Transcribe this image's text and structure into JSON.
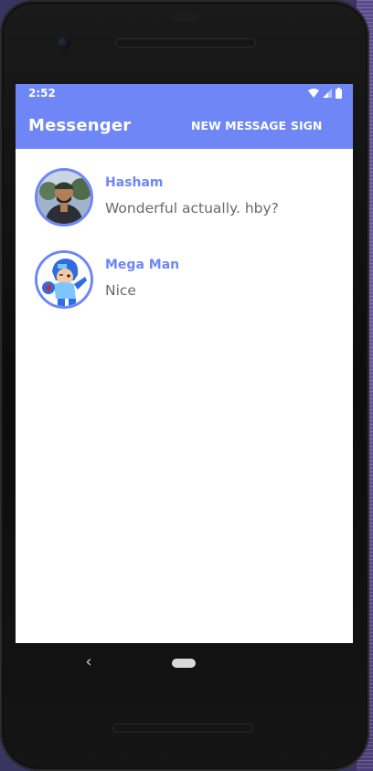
{
  "statusbar": {
    "time": "2:52"
  },
  "appbar": {
    "title": "Messenger",
    "new_message": "NEW MESSAGE",
    "sign_out": "SIGN OUT"
  },
  "conversations": [
    {
      "name": "Hasham",
      "last_message": "Wonderful actually. hby?",
      "avatar": "photo-avatar"
    },
    {
      "name": "Mega Man",
      "last_message": "Nice",
      "avatar": "mega-man-avatar"
    }
  ],
  "navigation": {
    "back": "‹"
  },
  "colors": {
    "accent": "#6e86f6",
    "name_text": "#6e86f6",
    "message_text": "#6a6a6a"
  }
}
